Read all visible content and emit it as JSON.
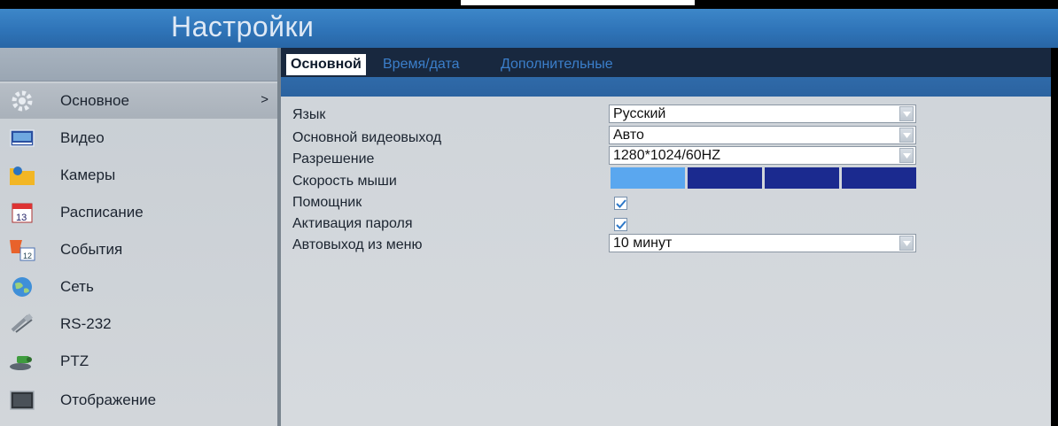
{
  "header": {
    "title": "Настройки"
  },
  "sidebar": {
    "items": [
      {
        "label": "Основное",
        "icon": "gear-icon",
        "active": true
      },
      {
        "label": "Видео",
        "icon": "video-icon"
      },
      {
        "label": "Камеры",
        "icon": "camera-folder-icon"
      },
      {
        "label": "Расписание",
        "icon": "calendar-icon"
      },
      {
        "label": "События",
        "icon": "events-flag-icon"
      },
      {
        "label": "Сеть",
        "icon": "globe-icon"
      },
      {
        "label": "RS-232",
        "icon": "serial-port-icon"
      },
      {
        "label": "PTZ",
        "icon": "ptz-icon"
      },
      {
        "label": "Отображение",
        "icon": "monitor-icon"
      }
    ],
    "active_arrow": ">"
  },
  "tabs": [
    {
      "label": "Основной",
      "active": true
    },
    {
      "label": "Время/дата",
      "active": false
    },
    {
      "label": "Дополнительные",
      "active": false
    }
  ],
  "settings": {
    "language_label": "Язык",
    "language_value": "Русский",
    "video_output_label": "Основной видеовыход",
    "video_output_value": "Авто",
    "resolution_label": "Разрешение",
    "resolution_value": "1280*1024/60HZ",
    "mouse_speed_label": "Скорость мыши",
    "mouse_speed_level": 1,
    "mouse_speed_max": 4,
    "assistant_label": "Помощник",
    "assistant_checked": true,
    "password_label": "Активация пароля",
    "password_checked": true,
    "auto_exit_label": "Автовыход из меню",
    "auto_exit_value": "10 минут"
  },
  "colors": {
    "header_blue": "#2f74b8",
    "tab_bar": "#18283f",
    "speed_active": "#5aa7ef",
    "speed_inactive": "#1b2a8f"
  }
}
